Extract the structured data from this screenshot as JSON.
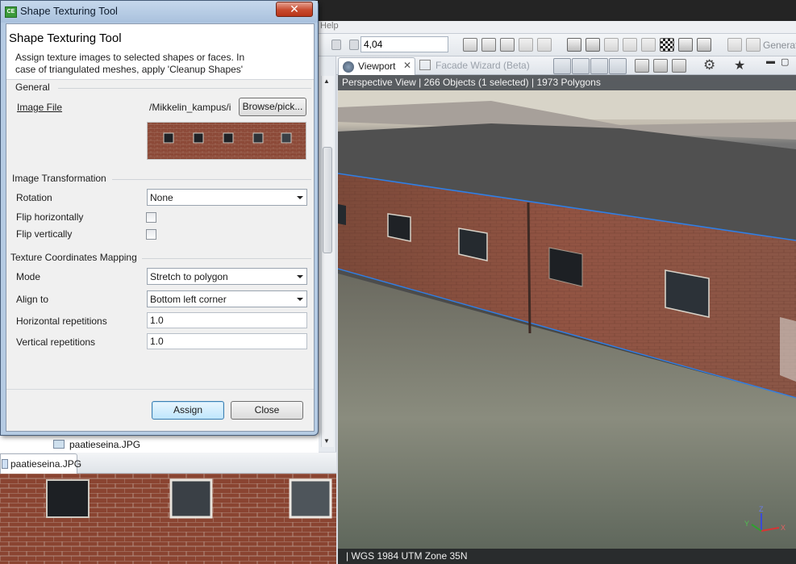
{
  "app": {
    "menu_help": "Help",
    "zoom_value": "4,04",
    "toolbar_right_label": "Generat",
    "viewport_tab_label": "Viewport",
    "facade_tab_label": "Facade Wizard (Beta)",
    "viewport_info": "Perspective View  |  266 Objects  (1 selected)  |  1973 Polygons",
    "viewport_status": "|  WGS 1984 UTM Zone 35N",
    "axis_x": "X",
    "axis_y": "Y",
    "axis_z": "Z"
  },
  "preview": {
    "tab_label": "paatieseina.JPG",
    "list_item_label": "paatieseina.JPG"
  },
  "dialog": {
    "window_title": "Shape Texturing Tool",
    "close_glyph": "✕",
    "heading": "Shape Texturing Tool",
    "description": "Assign texture images to selected shapes or faces. In case of triangulated meshes, apply 'Cleanup Shapes'",
    "general": {
      "title": "General",
      "image_file_label": "Image File",
      "image_file_path": "/Mikkelin_kampus/i",
      "browse_label": "Browse/pick..."
    },
    "transformation": {
      "title": "Image Transformation",
      "rotation_label": "Rotation",
      "rotation_value": "None",
      "flip_h_label": "Flip horizontally",
      "flip_h_checked": false,
      "flip_v_label": "Flip vertically",
      "flip_v_checked": false
    },
    "mapping": {
      "title": "Texture Coordinates Mapping",
      "mode_label": "Mode",
      "mode_value": "Stretch to polygon",
      "align_label": "Align to",
      "align_value": "Bottom left corner",
      "h_rep_label": "Horizontal repetitions",
      "h_rep_value": "1.0",
      "v_rep_label": "Vertical repetitions",
      "v_rep_value": "1.0"
    },
    "buttons": {
      "assign": "Assign",
      "close": "Close"
    }
  },
  "colors": {
    "dialog_frame": "#b5cbe3",
    "close_button": "#c74a2e",
    "brick": "#8b4632",
    "selection_edge": "#2f7fe6"
  }
}
